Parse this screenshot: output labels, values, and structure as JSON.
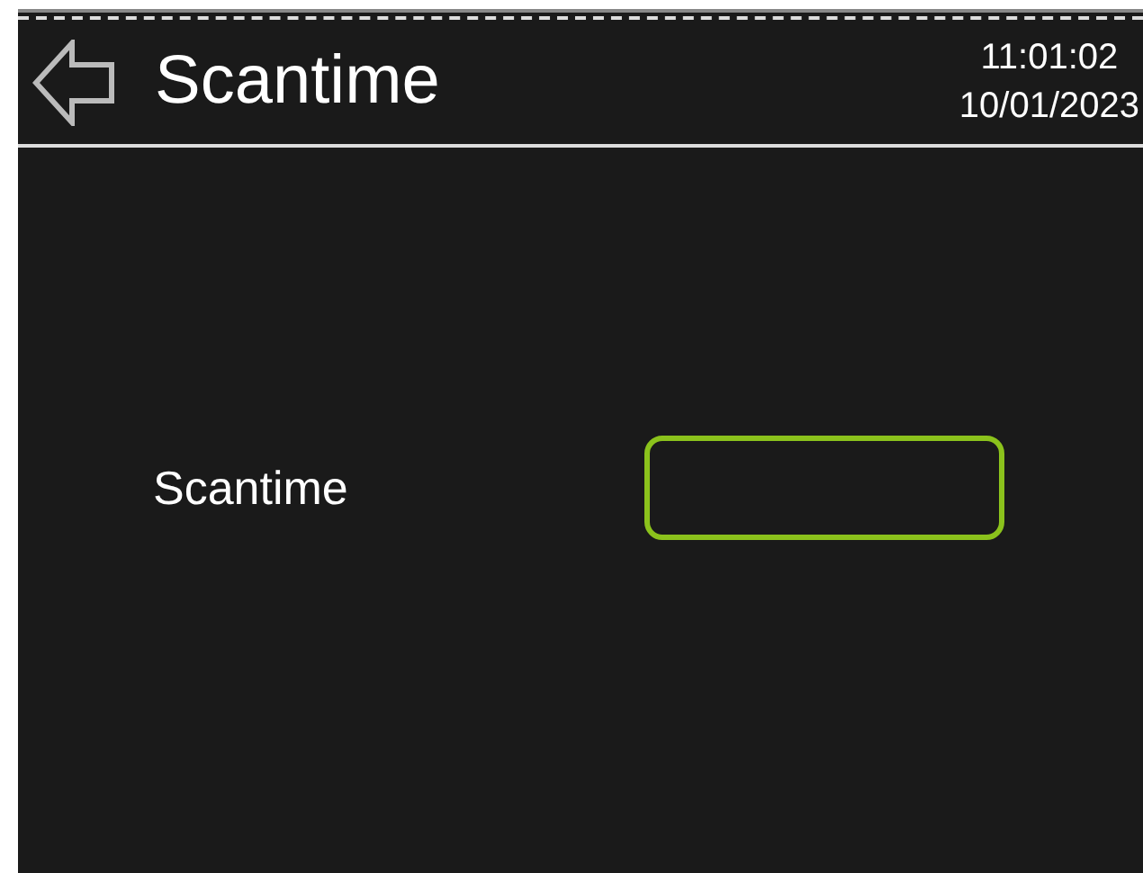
{
  "header": {
    "title": "Scantime",
    "time": "11:01:02",
    "date": "10/01/2023"
  },
  "form": {
    "label": "Scantime"
  }
}
